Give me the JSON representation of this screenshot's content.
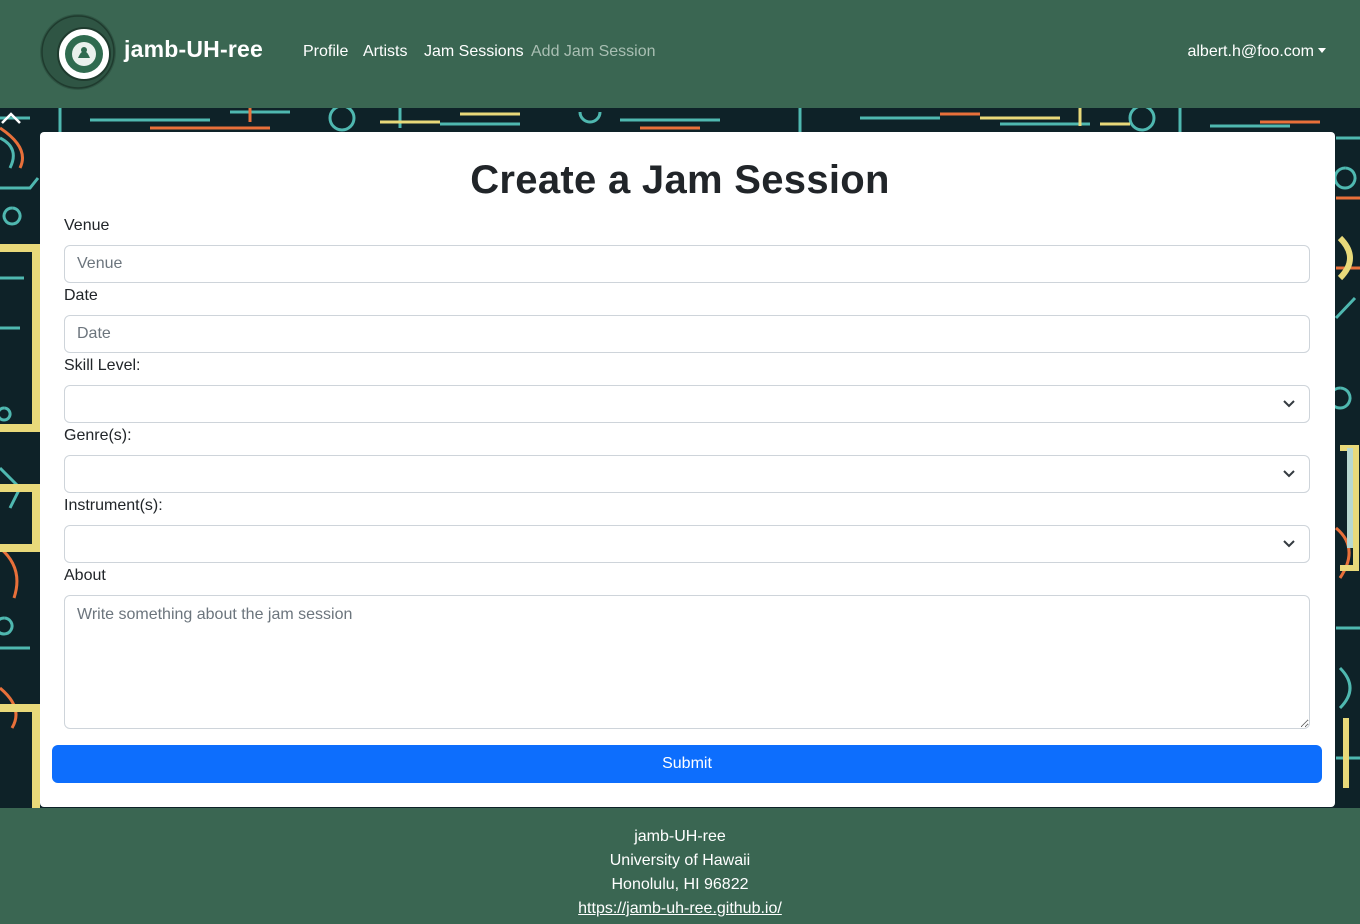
{
  "navbar": {
    "logo_alt": "University of Hawaii seal",
    "brand": "jamb-UH-ree",
    "links": [
      "Profile",
      "Artists",
      "Jam Sessions",
      "Add Jam Session"
    ],
    "user_email": "albert.h@foo.com"
  },
  "form": {
    "title": "Create a Jam Session",
    "venue_label": "Venue",
    "venue_placeholder": "Venue",
    "date_label": "Date",
    "date_placeholder": "Date",
    "skill_label": "Skill Level:",
    "genres_label": "Genre(s):",
    "instruments_label": "Instrument(s):",
    "about_label": "About",
    "about_placeholder": "Write something about the jam session",
    "submit_label": "Submit"
  },
  "footer": {
    "line1": "jamb-UH-ree",
    "line2": "University of Hawaii",
    "line3": "Honolulu, HI 96822",
    "link": "https://jamb-uh-ree.github.io/"
  },
  "colors": {
    "nav_bg": "#3a6652",
    "primary": "#0d6efd",
    "hero_bg": "#0e2228",
    "accent_teal": "#4fb8b0",
    "accent_orange": "#e8703a",
    "accent_yellow": "#e8d97a"
  }
}
